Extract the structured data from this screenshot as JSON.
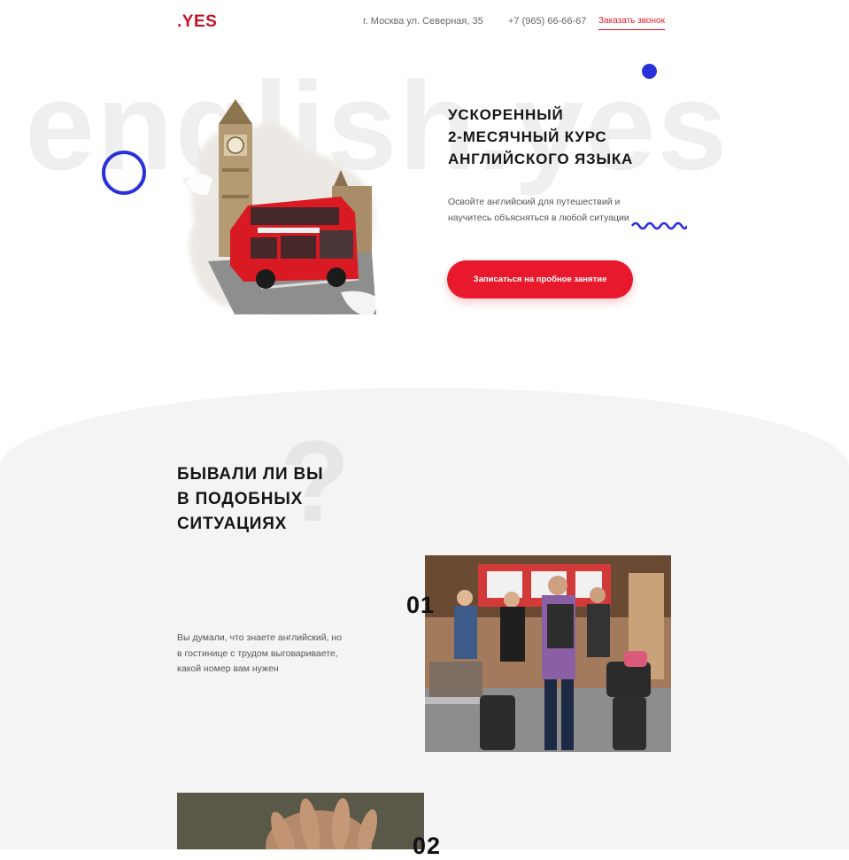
{
  "header": {
    "logo_dot": ".",
    "logo_word": "YES",
    "address": "г. Москва ул. Северная, 35",
    "phone": "+7 (965) 66-66-67",
    "callback_link": "Заказать звонок"
  },
  "hero": {
    "watermark": "english.yes",
    "title_line1": "УСКОРЕННЫЙ",
    "title_line2": "2-МЕСЯЧНЫЙ КУРС",
    "title_line3": "АНГЛИЙСКОГО ЯЗЫКА",
    "subtitle": "Освойте английский для путешествий и научитесь объясняться в любой ситуации",
    "cta_button": "Записаться на пробное занятие"
  },
  "situations": {
    "title_line1": "БЫВАЛИ ЛИ ВЫ",
    "title_line2": "В ПОДОБНЫХ",
    "title_line3": "СИТУАЦИЯХ",
    "question_mark": "?",
    "items": [
      {
        "number": "01",
        "text": "Вы думали, что знаете английский, но в гостинице с трудом выговариваете, какой номер вам нужен"
      },
      {
        "number": "02"
      }
    ]
  },
  "colors": {
    "accent_red": "#e8192c",
    "accent_blue": "#2931d8",
    "section_bg": "#f4f4f4"
  }
}
